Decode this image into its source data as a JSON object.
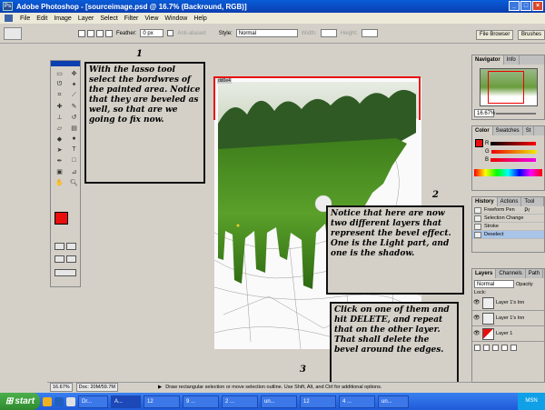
{
  "app": {
    "title": "Adobe Photoshop - [sourceimage.psd @ 16.7% (Backround, RGB)]",
    "window_buttons": [
      "_",
      "□",
      "×"
    ],
    "menu": [
      "File",
      "Edit",
      "Image",
      "Layer",
      "Select",
      "Filter",
      "View",
      "Window",
      "Help"
    ]
  },
  "options": {
    "feather_label": "Feather:",
    "feather_value": "0 px",
    "anti_alias": "Anti-aliased",
    "style_label": "Style:",
    "style_value": "Normal",
    "width_label": "Width:",
    "height_label": "Height:",
    "dock_tabs": [
      "File Browser",
      "Brushes"
    ]
  },
  "toolbox": {
    "tools": [
      "marquee-icon",
      "move-icon",
      "lasso-icon",
      "magic-wand-icon",
      "crop-icon",
      "slice-icon",
      "healing-icon",
      "brush-icon",
      "stamp-icon",
      "history-brush-icon",
      "eraser-icon",
      "gradient-icon",
      "blur-icon",
      "dodge-icon",
      "path-select-icon",
      "type-icon",
      "pen-icon",
      "shape-icon",
      "notes-icon",
      "eyedropper-icon",
      "hand-icon",
      "zoom-icon"
    ],
    "foreground": "#e80e0e",
    "background": "#ffffff"
  },
  "document": {
    "tag": "dd0e4"
  },
  "annotations": {
    "n1": "1",
    "note1": "With the lasso tool select the bordwres of the painted area. Notice that they are beveled as well, so that are we going to fix now.",
    "n2": "2",
    "note2": "Notice that here are now two different layers that represent the bevel effect. One is the Light part, and one is the shadow.",
    "n3": "3",
    "note3": "Click on one of them and hit DELETE, and repeat that on the other layer. That shall delete the bevel around the edges."
  },
  "navigator": {
    "tabs": [
      "Navigator",
      "Info"
    ],
    "zoom": "16.67%"
  },
  "color": {
    "tabs": [
      "Color",
      "Swatches",
      "St"
    ],
    "labels": [
      "R",
      "G",
      "B"
    ]
  },
  "history": {
    "tabs": [
      "History",
      "Actions",
      "Tool Pr"
    ],
    "items": [
      "Freeform Pen",
      "Selection Change",
      "Stroke",
      "Deselect"
    ]
  },
  "layers": {
    "tabs": [
      "Layers",
      "Channels",
      "Path"
    ],
    "blend": "Normal",
    "opacity_label": "Opacity",
    "lock_label": "Lock:",
    "rows": [
      "Layer 1's Inn",
      "Layer 1's Inn",
      "Layer 1"
    ]
  },
  "status": {
    "zoom": "16.67%",
    "doc": "Doc: 20M/59.7M",
    "hint": "Draw rectangular selection or move selection outline. Use Shift, Alt, and Ctrl for additional options."
  },
  "taskbar": {
    "start": "start",
    "items": [
      "Dr...",
      "A...",
      "12",
      "9 ...",
      "2 ...",
      "un...",
      "12",
      "4 ...",
      "un..."
    ],
    "clock": "MSN"
  },
  "colors": {
    "selection": "#e81010",
    "title_blue": "#0a5cd8",
    "grass": "#5aa02a"
  }
}
